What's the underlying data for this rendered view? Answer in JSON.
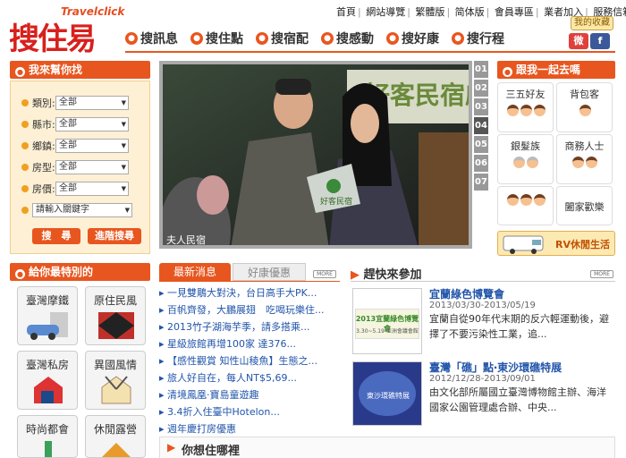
{
  "logo": {
    "tagline": "Travelclick",
    "mark": "搜住易"
  },
  "toplinks": [
    "首頁",
    "網站導覽",
    "繁體版",
    "简体版",
    "會員專區",
    "業者加入",
    "服務信箱"
  ],
  "favorite": "我的收藏",
  "social": [
    "微",
    "f"
  ],
  "nav": [
    "搜訊息",
    "搜住點",
    "搜宿配",
    "搜感動",
    "搜好康",
    "搜行程"
  ],
  "search": {
    "title": "我來幫你找",
    "fields": [
      {
        "label": "類別:",
        "value": "全部"
      },
      {
        "label": "縣市:",
        "value": "全部"
      },
      {
        "label": "鄉鎮:",
        "value": "全部"
      },
      {
        "label": "房型:",
        "value": "全部"
      },
      {
        "label": "房價:",
        "value": "全部"
      }
    ],
    "keyword_placeholder": "請輸入關鍵字",
    "search_btn": "搜　尋",
    "advanced_btn": "進階搜尋"
  },
  "banner": {
    "caption": "夫人民宿",
    "tabs": [
      "01",
      "02",
      "03",
      "04",
      "05",
      "06",
      "07"
    ],
    "active_tab": "04",
    "sign_text": "好客民宿",
    "banner_text": "好客民宿啟動"
  },
  "together": {
    "title": "跟我一起去嗎",
    "types": [
      "三五好友",
      "背包客",
      "銀髮族",
      "商務人士",
      "",
      "闔家歡樂"
    ],
    "rv": "RV休閒生活"
  },
  "special": {
    "title": "給你最特別的",
    "items": [
      "臺灣摩鐵",
      "原住民風",
      "臺灣私房",
      "異國風情",
      "時尚都會",
      "休閒露營"
    ]
  },
  "news": {
    "tabs": [
      "最新消息",
      "好康優惠"
    ],
    "more": "MORE",
    "items": [
      "一見雙鵰大對決，台日高手大PK...",
      "百帆齊發，大鵬展翅　吃喝玩樂住...",
      "2013竹子湖海芋季，請多搭乘...",
      "星級旅館再增100家 達376...",
      "【感性觀賞 知性山稜魚】生態之...",
      "旅人好自在，每人NT$5,69...",
      "清境鳳凰‧寶島童遊趣",
      "3.4折入住臺中Hotelon...",
      "週年慶打房優惠"
    ]
  },
  "events": {
    "title": "趕快來參加",
    "more": "MORE",
    "items": [
      {
        "title": "宜蘭綠色博覽會",
        "date": "2013/03/30-2013/05/19",
        "desc": "宜蘭自從90年代末期的反六輕運動後，避擇了不要污染性工業，追...",
        "img_title": "2013宜蘭綠色博覽會",
        "img_date": "3.30~5.19 亞洲會議會館"
      },
      {
        "title": "臺灣「礁」點‧東沙環礁特展",
        "date": "2012/12/28-2013/09/01",
        "desc": "由文化部所屬國立臺灣博物館主辦、海洋國家公園管理處合辦、中央...",
        "img_title": "東沙環礁特展"
      }
    ]
  },
  "where": {
    "title": "你想住哪裡"
  }
}
